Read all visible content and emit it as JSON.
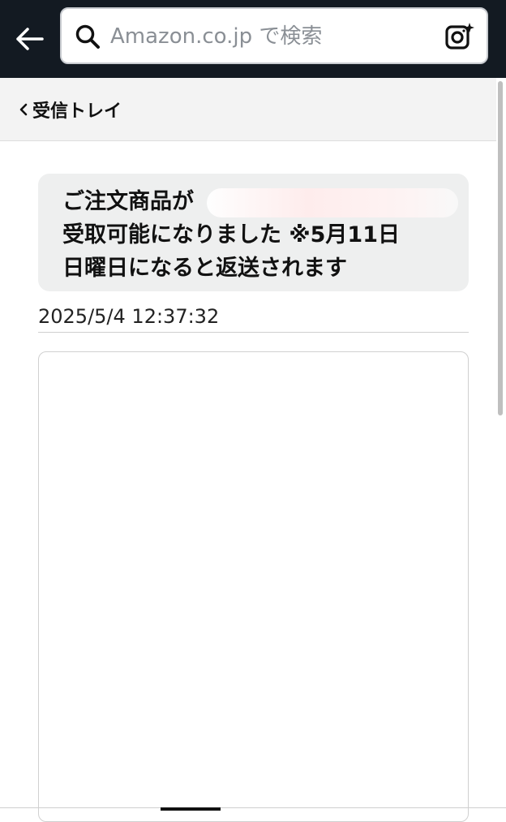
{
  "header": {
    "search": {
      "placeholder": "Amazon.co.jp で検索"
    }
  },
  "subheader": {
    "back_label": "受信トレイ"
  },
  "message": {
    "text": "ご注文商品が\n受取可能になりました ※5月11日\n日曜日になると返送されます",
    "timestamp": "2025/5/4 12:37:32"
  },
  "icons": {
    "back": "arrow-left-icon",
    "search": "search-icon",
    "camera": "camera-sparkle-icon",
    "chevron": "chevron-left-icon"
  },
  "colors": {
    "top_bar": "#131a22",
    "subheader_bg": "#f3f3f3",
    "bubble_bg": "#eeefef"
  }
}
